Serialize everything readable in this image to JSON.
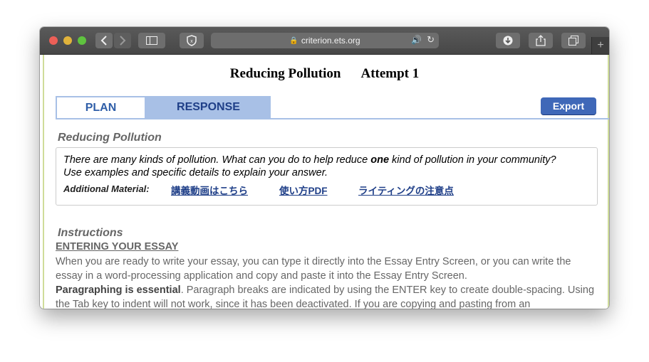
{
  "browser": {
    "url": "criterion.ets.org",
    "icons": [
      "back-icon",
      "forward-icon",
      "sidebar-icon",
      "privacy-shield-icon",
      "lock-icon",
      "audio-icon",
      "reload-icon",
      "download-icon",
      "share-icon",
      "tabs-icon",
      "new-tab-icon"
    ],
    "new_tab_label": "+"
  },
  "page": {
    "title": "Reducing Pollution",
    "attempt": "Attempt 1",
    "tabs": [
      {
        "label": "PLAN",
        "active": false
      },
      {
        "label": "RESPONSE",
        "active": true
      }
    ],
    "export_label": "Export",
    "prompt_heading": "Reducing Pollution",
    "prompt": {
      "line1_before": "There are many kinds of pollution. What can you do to help reduce ",
      "line1_bold": "one",
      "line1_after": " kind of pollution in your community?",
      "line2": "Use examples and specific details to explain your answer.",
      "additional_label": "Additional Material:",
      "links": [
        "講義動画はこちら",
        "使い方PDF",
        "ライティングの注意点"
      ]
    },
    "instructions_heading": "Instructions",
    "entering_heading": "ENTERING YOUR ESSAY",
    "para1": "When you are ready to write your essay, you can type it directly into the Essay Entry Screen, or you can write the essay in a word-processing application and copy and paste it into the Essay Entry Screen.",
    "para2_bold": "Paragraphing is essential",
    "para2_rest": ". Paragraph breaks are indicated by using the ENTER key to create double-spacing. Using the Tab key to indent will not work, since it has been deactivated. If you are copying and pasting from an"
  },
  "colors": {
    "tab_active_bg": "#a8c0e6",
    "tab_text": "#2f5ea8",
    "link": "#1f3f88",
    "export_bg": "#3f68b8",
    "frame_edge": "#cfdc9a"
  }
}
